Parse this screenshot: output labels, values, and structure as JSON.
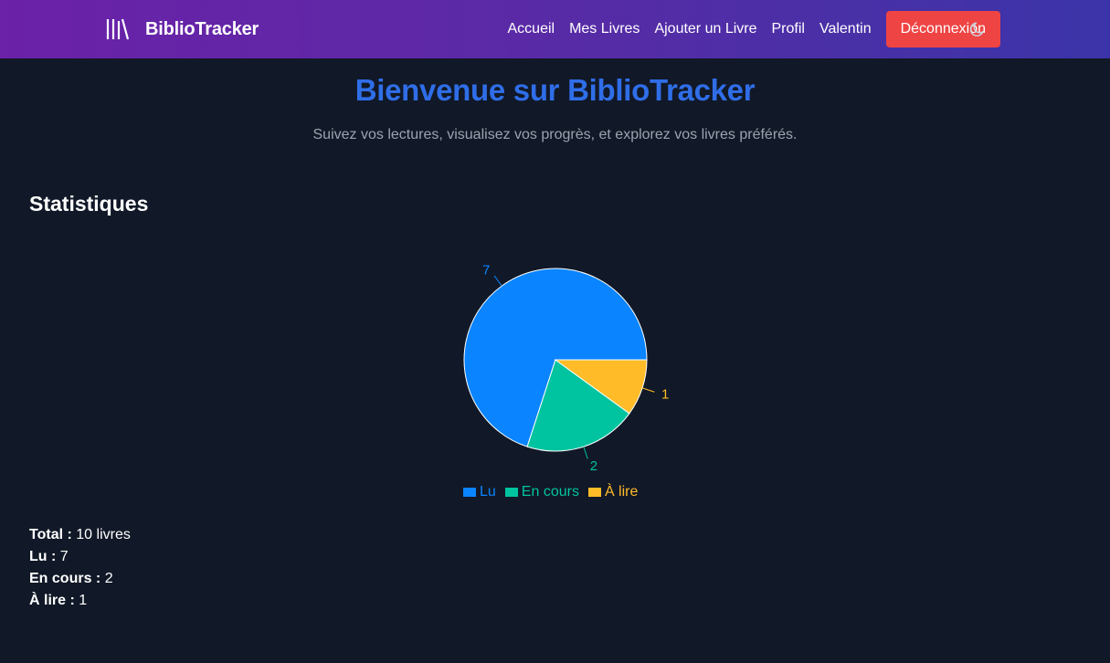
{
  "header": {
    "brand": "BiblioTracker",
    "brand_icon": "library-icon",
    "nav": [
      "Accueil",
      "Mes Livres",
      "Ajouter un Livre",
      "Profil",
      "Valentin"
    ],
    "logout_label": "Déconnexion",
    "theme_icon": "moon-icon"
  },
  "hero": {
    "title": "Bienvenue sur BiblioTracker",
    "subtitle": "Suivez vos lectures, visualisez vos progrès, et explorez vos livres préférés."
  },
  "stats": {
    "title": "Statistiques",
    "summary": [
      {
        "label": "Total :",
        "value": "10 livres"
      },
      {
        "label": "Lu :",
        "value": "7"
      },
      {
        "label": "En cours :",
        "value": "2"
      },
      {
        "label": "À lire :",
        "value": "1"
      }
    ]
  },
  "colors": {
    "accent": "#2f6ee8",
    "danger": "#ef4444",
    "background": "#111827"
  },
  "chart_data": {
    "type": "pie",
    "categories": [
      "Lu",
      "En cours",
      "À lire"
    ],
    "values": [
      7,
      2,
      1
    ],
    "colors": [
      "#0a84ff",
      "#00c49f",
      "#ffbb28"
    ],
    "legend_position": "bottom",
    "data_labels": [
      "7",
      "2",
      "1"
    ]
  }
}
